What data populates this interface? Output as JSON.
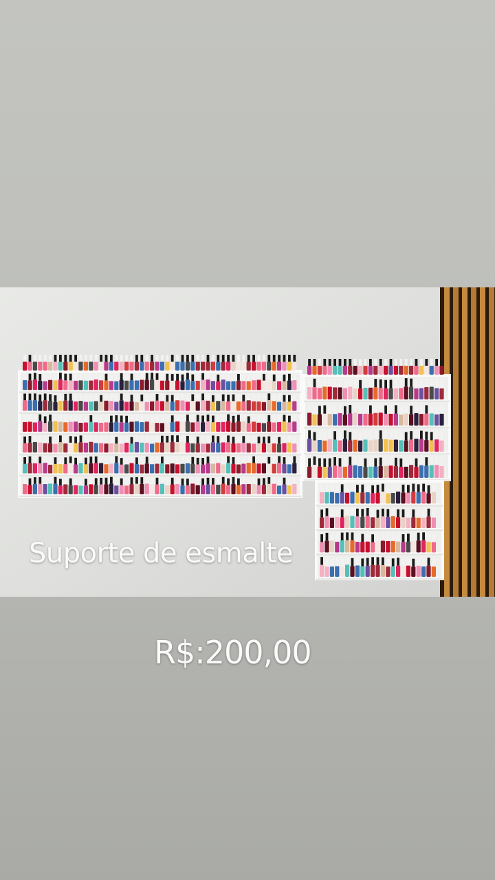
{
  "story": {
    "title": "Suporte de esmalte",
    "price": "R$:200,00"
  },
  "photo": {
    "subject": "wall-mounted-nail-polish-shelves",
    "colors": {
      "wall": "#e3e4e1",
      "shelf": "#f6f6f4",
      "wood_light": "#c48a3e",
      "wood_dark": "#2c1a0c",
      "backdrop": "#bfc0bc"
    },
    "polish_palette": [
      "#c8102e",
      "#e0245e",
      "#f06a8a",
      "#f3b1c1",
      "#8b1a2b",
      "#5a1020",
      "#d9b8a0",
      "#e8d3c4",
      "#2a1f3d",
      "#3a6fb0",
      "#55c0b8",
      "#f2c14e",
      "#e86a2a",
      "#b83a8c",
      "#f5e6e0",
      "#9e2a3a",
      "#6b4fa0",
      "#d33c3c",
      "#ef8fb3",
      "#4a4a4a"
    ]
  }
}
